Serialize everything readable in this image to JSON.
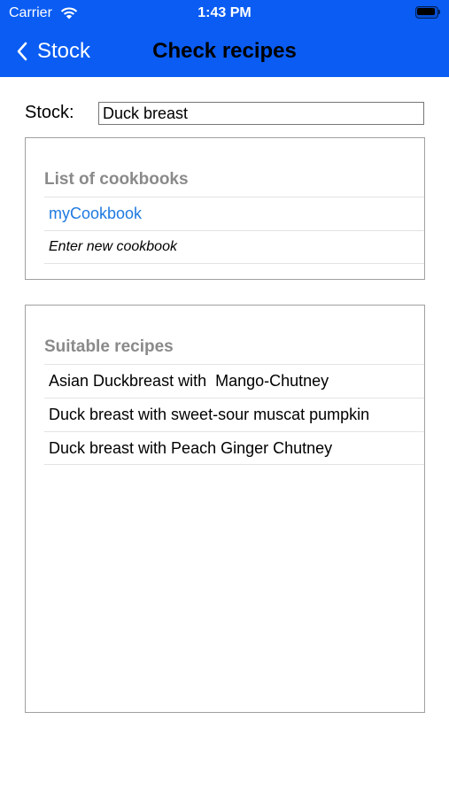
{
  "status_bar": {
    "carrier": "Carrier",
    "time": "1:43 PM"
  },
  "nav": {
    "back_label": "Stock",
    "title": "Check recipes"
  },
  "stock": {
    "label": "Stock:",
    "value": "Duck breast"
  },
  "cookbooks": {
    "header": "List of cookbooks",
    "items": [
      {
        "label": "myCookbook"
      }
    ],
    "new_entry": "Enter new cookbook"
  },
  "recipes": {
    "header": "Suitable recipes",
    "items": [
      {
        "label": "Asian Duckbreast with  Mango-Chutney"
      },
      {
        "label": "Duck breast with sweet-sour muscat pumpkin"
      },
      {
        "label": "Duck breast with Peach Ginger Chutney"
      }
    ]
  },
  "colors": {
    "header_background": "#0a5cf2",
    "link": "#1f7ae0",
    "section_header": "#8a8a8a"
  },
  "icons": {
    "back": "chevron-left-icon",
    "wifi": "wifi-icon",
    "battery": "battery-icon"
  }
}
